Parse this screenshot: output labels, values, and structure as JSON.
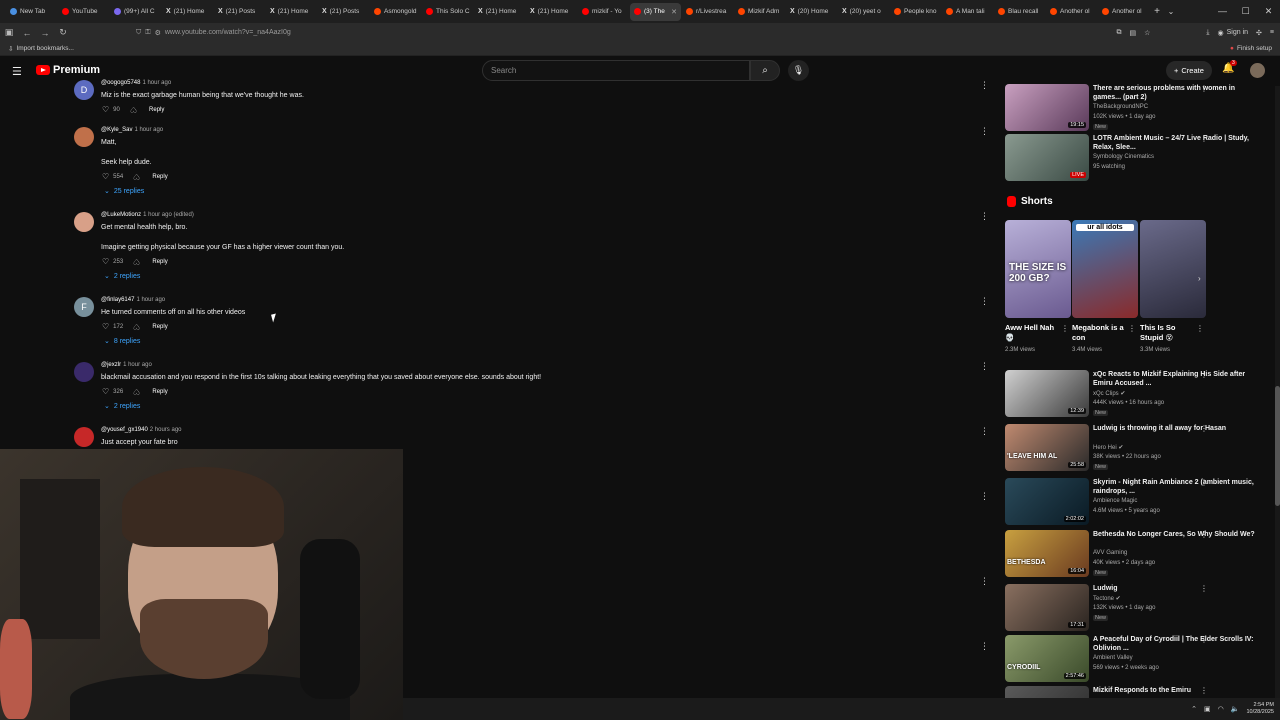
{
  "browser": {
    "tabs": [
      {
        "label": "New Tab",
        "color": "#4a90e2",
        "kind": "dot"
      },
      {
        "label": "YouTube",
        "color": "#ff0000",
        "kind": "dot"
      },
      {
        "label": "(99+) All C",
        "color": "#7b68ee",
        "kind": "dot"
      },
      {
        "label": "(21) Home",
        "color": "",
        "kind": "x"
      },
      {
        "label": "(21) Posts",
        "color": "",
        "kind": "x"
      },
      {
        "label": "(21) Home",
        "color": "",
        "kind": "x"
      },
      {
        "label": "(21) Posts",
        "color": "",
        "kind": "x"
      },
      {
        "label": "Asmongold",
        "color": "#ff4500",
        "kind": "dot"
      },
      {
        "label": "This Solo C",
        "color": "#ff0000",
        "kind": "dot"
      },
      {
        "label": "(21) Home",
        "color": "",
        "kind": "x"
      },
      {
        "label": "(21) Home",
        "color": "",
        "kind": "x"
      },
      {
        "label": "mizkif - Yo",
        "color": "#ff0000",
        "kind": "dot"
      },
      {
        "label": "(3) The",
        "color": "#ff0000",
        "kind": "dot",
        "active": true
      },
      {
        "label": "r/Livestrea",
        "color": "#ff4500",
        "kind": "dot"
      },
      {
        "label": "Mizkif Adm",
        "color": "#ff4500",
        "kind": "dot"
      },
      {
        "label": "(20) Home",
        "color": "",
        "kind": "x"
      },
      {
        "label": "(20) yeet o",
        "color": "",
        "kind": "x"
      },
      {
        "label": "People kno",
        "color": "#ff4500",
        "kind": "dot"
      },
      {
        "label": "A Man tali",
        "color": "#ff4500",
        "kind": "dot"
      },
      {
        "label": "Blau recall",
        "color": "#ff4500",
        "kind": "dot"
      },
      {
        "label": "Another ol",
        "color": "#ff4500",
        "kind": "dot"
      },
      {
        "label": "Another ol",
        "color": "#ff4500",
        "kind": "dot"
      }
    ],
    "url": "www.youtube.com/watch?v=_na4AazI0g",
    "sign_in": "Sign in",
    "import_bookmarks": "Import bookmarks...",
    "finish_setup": "Finish setup"
  },
  "header": {
    "logo": "Premium",
    "search_placeholder": "Search",
    "create": "Create",
    "notif_count": "3"
  },
  "comments": [
    {
      "initial": "D",
      "avatar_color": "#5c6bc0",
      "user": "@oogogo5748",
      "time": "1 hour ago",
      "lines": [
        "Miz is the exact garbage human being that we've thought he was."
      ],
      "likes": "90",
      "replies": ""
    },
    {
      "initial": "",
      "avatar_color": "#c0704a",
      "user": "@Kyle_Sav",
      "time": "1 hour ago",
      "lines": [
        "Matt,",
        "",
        "Seek help dude."
      ],
      "likes": "554",
      "replies": "25 replies"
    },
    {
      "initial": "",
      "avatar_color": "#d8a088",
      "user": "@LukeMotionz",
      "time": "1 hour ago (edited)",
      "lines": [
        "Get mental health help, bro.",
        "",
        "Imagine getting physical because your GF has a higher viewer count than you."
      ],
      "likes": "253",
      "replies": "2 replies"
    },
    {
      "initial": "F",
      "avatar_color": "#78909c",
      "user": "@finlay6147",
      "time": "1 hour ago",
      "lines": [
        "He turned comments off on all his other videos"
      ],
      "likes": "172",
      "replies": "8 replies"
    },
    {
      "initial": "",
      "avatar_color": "#3a2a6a",
      "user": "@jexzlr",
      "time": "1 hour ago",
      "lines": [
        "blackmail accusation and you respond in the first 10s talking about leaking everything that you saved about everyone else. sounds about right!"
      ],
      "likes": "326",
      "replies": "2 replies"
    },
    {
      "initial": "",
      "avatar_color": "#c62828",
      "user": "@yousef_gx1940",
      "time": "2 hours ago",
      "lines": [
        "Just accept your fate bro"
      ],
      "likes": "",
      "replies": ""
    }
  ],
  "reply_label": "Reply",
  "sidebar_top": [
    {
      "title": "There are serious problems with women in games... (part 2)",
      "channel": "TheBackgroundNPC",
      "meta": "102K views • 1 day ago",
      "new": "New",
      "duration": "19:15",
      "live": "",
      "colors": [
        "#c9a0c0",
        "#5a3a5a"
      ]
    },
    {
      "title": "LOTR Ambient Music – 24/7 Live Radio | Study, Relax, Slee...",
      "channel": "Symbology Cinematics",
      "meta": "95 watching",
      "new": "",
      "duration": "",
      "live": "LIVE",
      "colors": [
        "#8a9a90",
        "#3a4a44"
      ]
    }
  ],
  "shorts": {
    "heading": "Shorts",
    "items": [
      {
        "title": "Aww Hell Nah 💀",
        "views": "2.3M views",
        "overlay": "THE SIZE IS 200 GB?",
        "colors": [
          "#b8b0d8",
          "#6a5a90"
        ]
      },
      {
        "title": "Megabonk is a con",
        "views": "3.4M views",
        "overlay": "ur all idots",
        "colors": [
          "#3a7ab8",
          "#8a2a2a"
        ]
      },
      {
        "title": "This Is So Stupid 😵",
        "views": "3.3M views",
        "overlay": "",
        "colors": [
          "#6a6a8a",
          "#2a2a3a"
        ]
      }
    ]
  },
  "sidebar_bottom": [
    {
      "title": "xQc Reacts to Mizkif Explaining His Side after Emiru Accused ...",
      "channel": "xQc Clips ✔",
      "meta": "444K views • 16 hours ago",
      "new": "New",
      "duration": "12:39",
      "colors": [
        "#d0d0d0",
        "#3a3a3a"
      ]
    },
    {
      "title": "Ludwig is throwing it all away for Hasan",
      "channel": "Hero Hei ✔",
      "meta": "38K views • 22 hours ago",
      "new": "New",
      "duration": "25:58",
      "overlay": "'LEAVE HIM AL",
      "colors": [
        "#c08a70",
        "#2a2a2a"
      ]
    },
    {
      "title": "Skyrim - Night Rain Ambiance 2 (ambient music, raindrops, ...",
      "channel": "Ambience Magic",
      "meta": "4.6M views • 5 years ago",
      "new": "",
      "duration": "2:02:02",
      "colors": [
        "#2a4a5a",
        "#0a1a24"
      ]
    },
    {
      "title": "Bethesda No Longer Cares, So Why Should We?",
      "channel": "AVV Gaming",
      "meta": "40K views • 2 days ago",
      "new": "New",
      "duration": "16:04",
      "overlay": "BETHESDA",
      "colors": [
        "#c8a040",
        "#6a3a20"
      ]
    },
    {
      "title": "Ludwig",
      "channel": "Tectone ✔",
      "meta": "132K views • 1 day ago",
      "new": "New",
      "duration": "17:31",
      "colors": [
        "#8a7060",
        "#2a2420"
      ]
    },
    {
      "title": "A Peaceful Day of Cyrodiil | The Elder Scrolls IV: Oblivion ...",
      "channel": "Ambient Valley",
      "meta": "569 views • 2 weeks ago",
      "new": "",
      "duration": "2:57:46",
      "overlay": "CYRODIIL",
      "colors": [
        "#8a9a6a",
        "#3a4a2a"
      ]
    },
    {
      "title": "Mizkif Responds to the Emiru",
      "channel": "",
      "meta": "",
      "new": "",
      "duration": "",
      "colors": [
        "#5a5a5a",
        "#2a2a2a"
      ]
    }
  ],
  "clock": {
    "time": "2:54 PM",
    "date": "10/28/2025"
  }
}
